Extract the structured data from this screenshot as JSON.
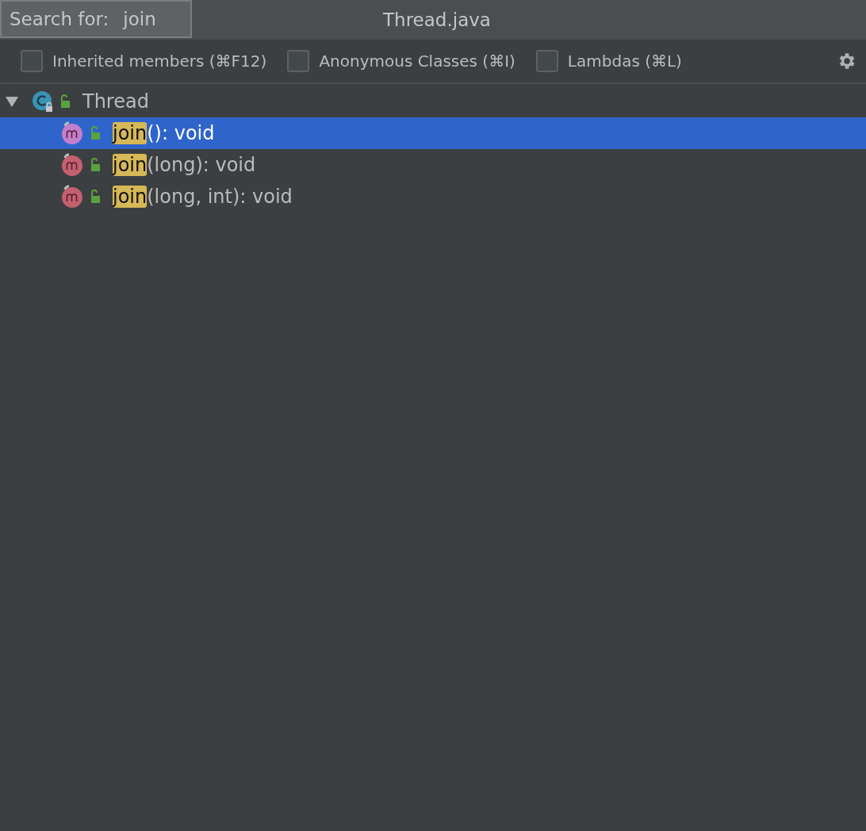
{
  "search": {
    "label": "Search for:",
    "value": "join"
  },
  "window": {
    "title": "Thread.java"
  },
  "filters": [
    {
      "label": "Inherited members (⌘F12)",
      "checked": false
    },
    {
      "label": "Anonymous Classes (⌘I)",
      "checked": false
    },
    {
      "label": "Lambdas (⌘L)",
      "checked": false
    }
  ],
  "tree": {
    "label": "Thread",
    "expanded": true,
    "children": [
      {
        "match": "join",
        "rest": "(): void",
        "selected": true
      },
      {
        "match": "join",
        "rest": "(long): void",
        "selected": false
      },
      {
        "match": "join",
        "rest": "(long, int): void",
        "selected": false
      }
    ]
  }
}
